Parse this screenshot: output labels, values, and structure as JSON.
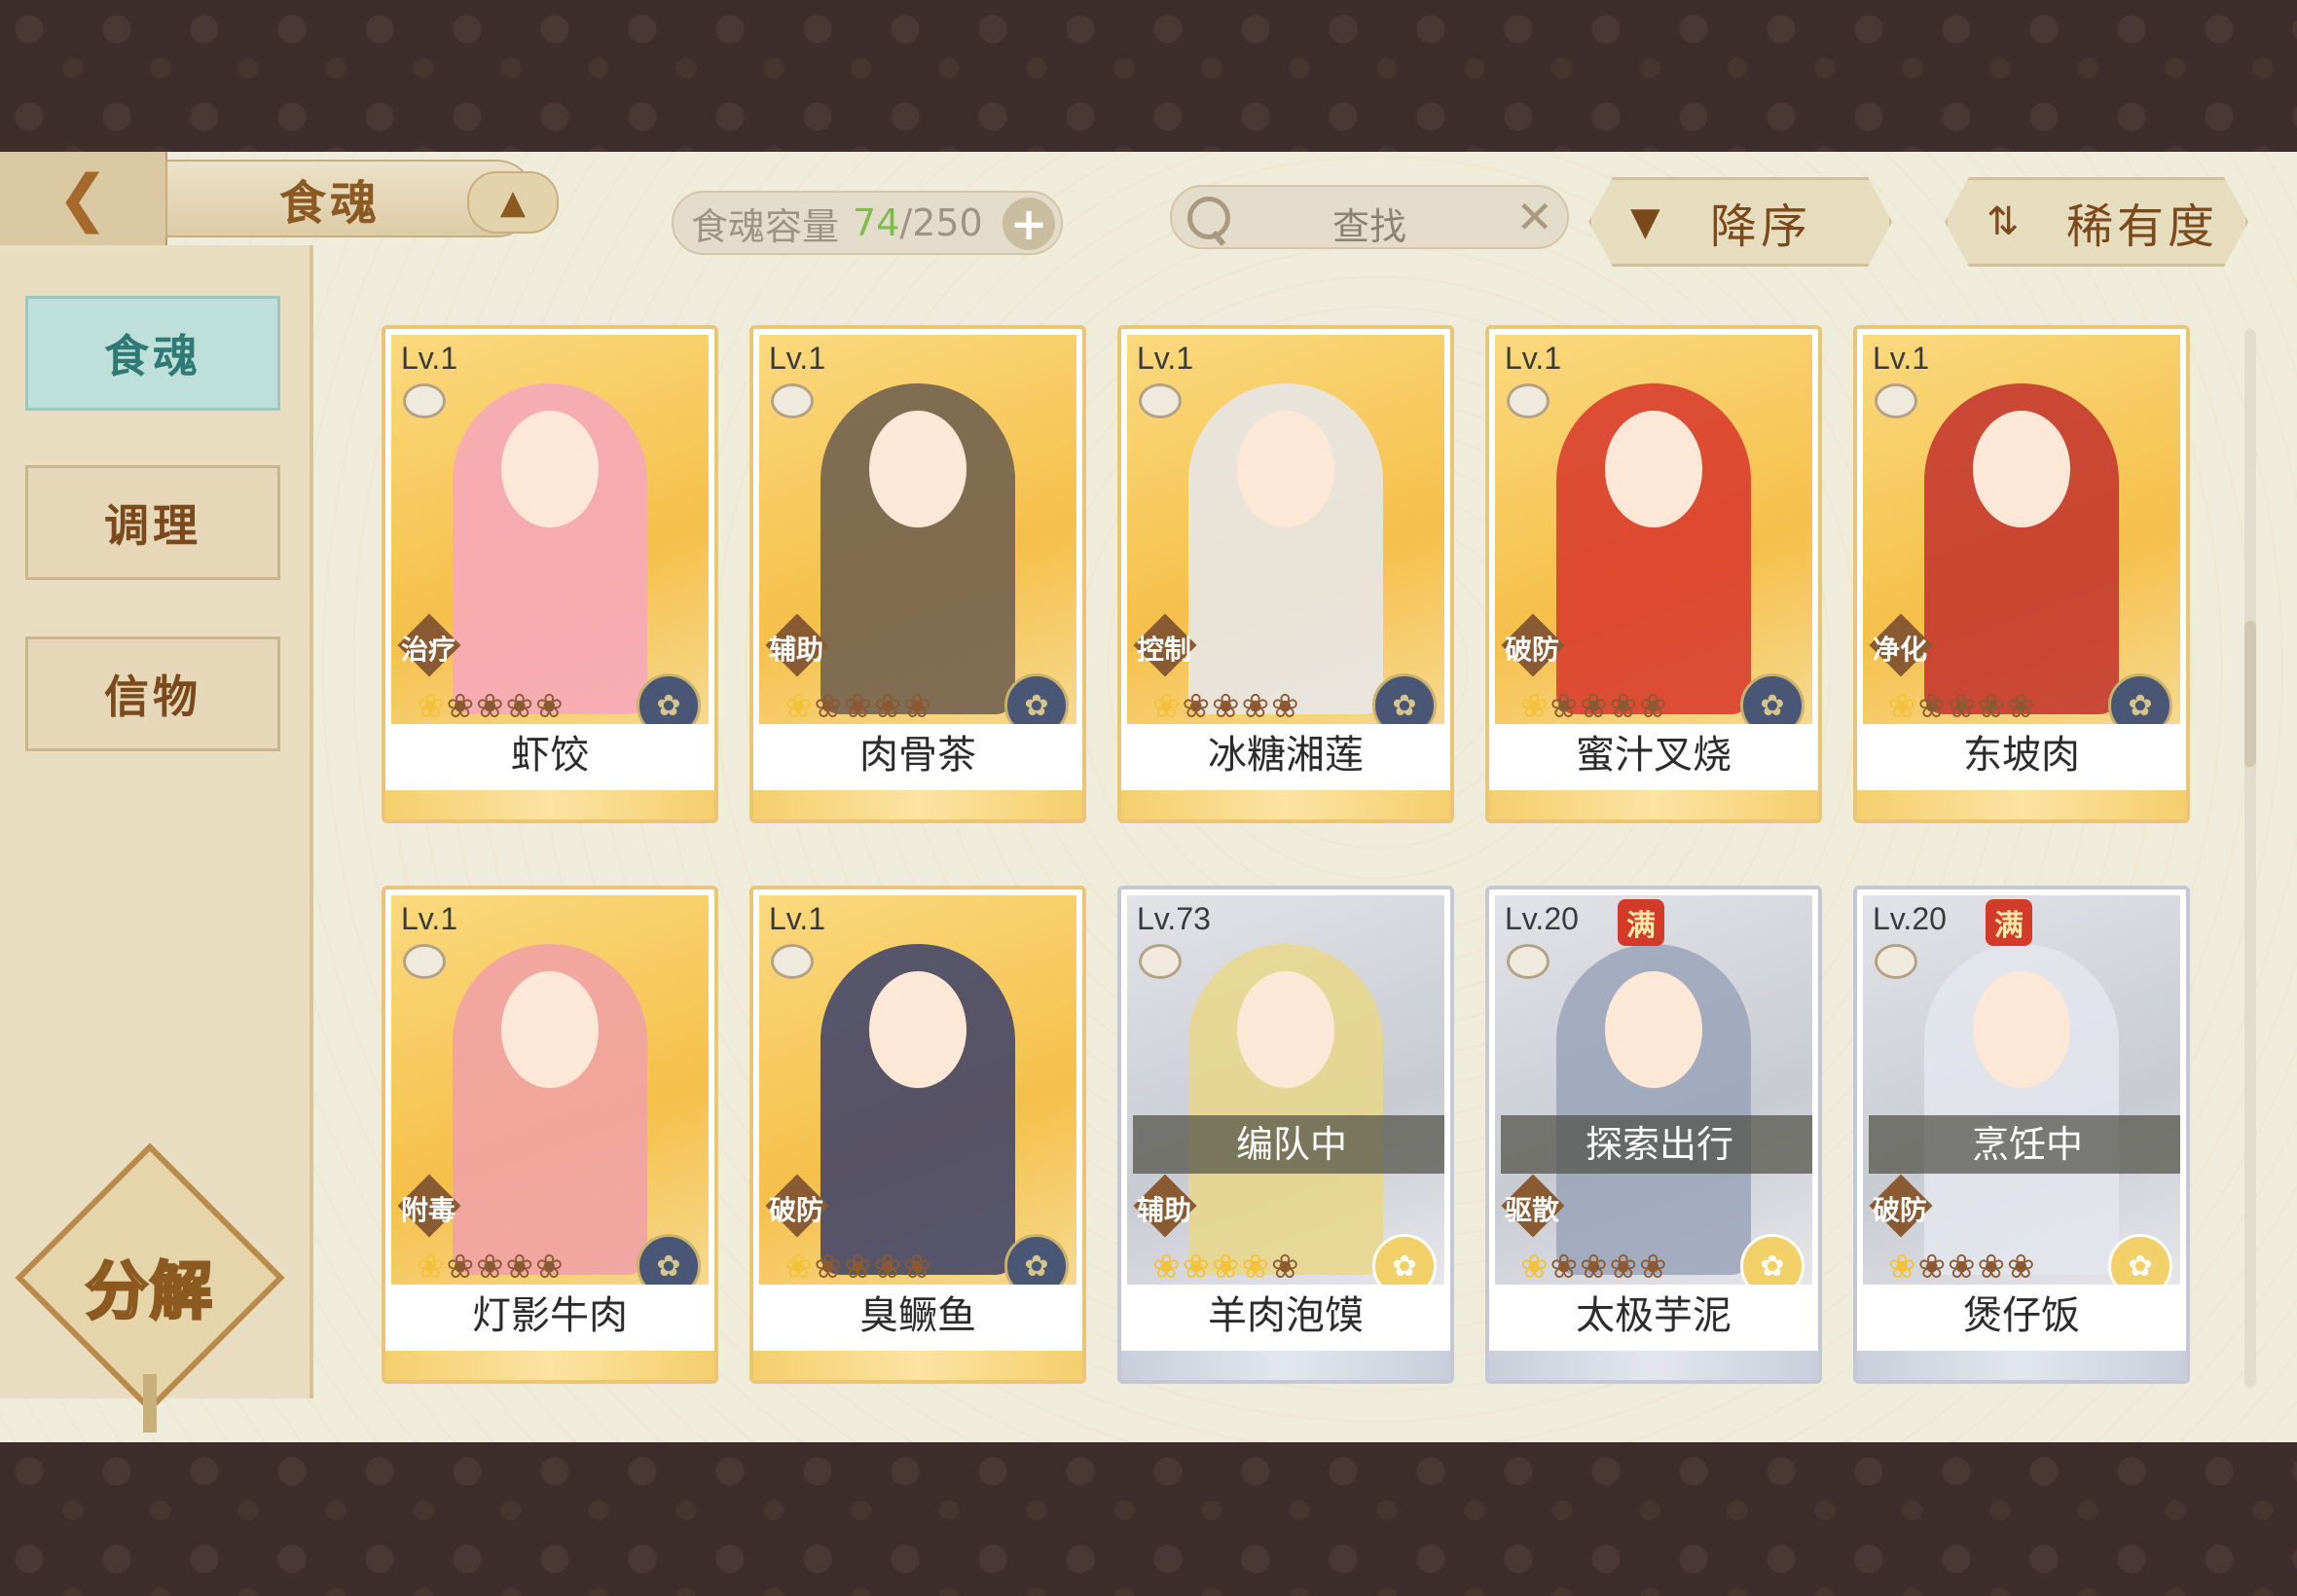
{
  "header": {
    "title": "食魂",
    "capacity_label": "食魂容量",
    "capacity_current": "74",
    "capacity_separator": "/",
    "capacity_max": "250",
    "search_placeholder": "查找",
    "sort_order": "降序",
    "sort_key": "稀有度"
  },
  "sidebar": {
    "tabs": [
      {
        "label": "食魂",
        "active": true
      },
      {
        "label": "调理",
        "active": false
      },
      {
        "label": "信物",
        "active": false
      }
    ],
    "decompose_label": "分解"
  },
  "cards": [
    {
      "level": "Lv.1",
      "name": "虾饺",
      "role": "治疗",
      "stars": 1,
      "max": false,
      "status": "",
      "theme": "gold",
      "rarity_icon": "blue",
      "hair": "#f6a7bd"
    },
    {
      "level": "Lv.1",
      "name": "肉骨茶",
      "role": "辅助",
      "stars": 1,
      "max": false,
      "status": "",
      "theme": "gold",
      "rarity_icon": "blue",
      "hair": "#6b5c4d"
    },
    {
      "level": "Lv.1",
      "name": "冰糖湘莲",
      "role": "控制",
      "stars": 1,
      "max": false,
      "status": "",
      "theme": "gold",
      "rarity_icon": "blue",
      "hair": "#e6e8ef"
    },
    {
      "level": "Lv.1",
      "name": "蜜汁叉烧",
      "role": "破防",
      "stars": 1,
      "max": false,
      "status": "",
      "theme": "gold",
      "rarity_icon": "blue",
      "hair": "#d8352c"
    },
    {
      "level": "Lv.1",
      "name": "东坡肉",
      "role": "净化",
      "stars": 1,
      "max": false,
      "status": "",
      "theme": "gold",
      "rarity_icon": "blue",
      "hair": "#c2302b"
    },
    {
      "level": "Lv.1",
      "name": "灯影牛肉",
      "role": "附毒",
      "stars": 1,
      "max": false,
      "status": "",
      "theme": "gold",
      "rarity_icon": "blue",
      "hair": "#f0a0a8"
    },
    {
      "level": "Lv.1",
      "name": "臭鳜鱼",
      "role": "破防",
      "stars": 1,
      "max": false,
      "status": "",
      "theme": "gold",
      "rarity_icon": "blue",
      "hair": "#3b3f6a"
    },
    {
      "level": "Lv.73",
      "name": "羊肉泡馍",
      "role": "辅助",
      "stars": 4,
      "max": false,
      "status": "编队中",
      "theme": "grey",
      "rarity_icon": "gold",
      "hair": "#e9d78a"
    },
    {
      "level": "Lv.20",
      "name": "太极芋泥",
      "role": "驱散",
      "stars": 1,
      "max": true,
      "status": "探索出行",
      "theme": "grey",
      "rarity_icon": "gold",
      "hair": "#9aa3b8"
    },
    {
      "level": "Lv.20",
      "name": "煲仔饭",
      "role": "破防",
      "stars": 1,
      "max": true,
      "status": "烹饪中",
      "theme": "grey",
      "rarity_icon": "gold",
      "hair": "#e4e6ee"
    }
  ],
  "max_badge": "满",
  "colors": {
    "accent": "#8a5a22",
    "active_tab": "#bfe0da",
    "capacity_current": "#7dbb4d"
  }
}
